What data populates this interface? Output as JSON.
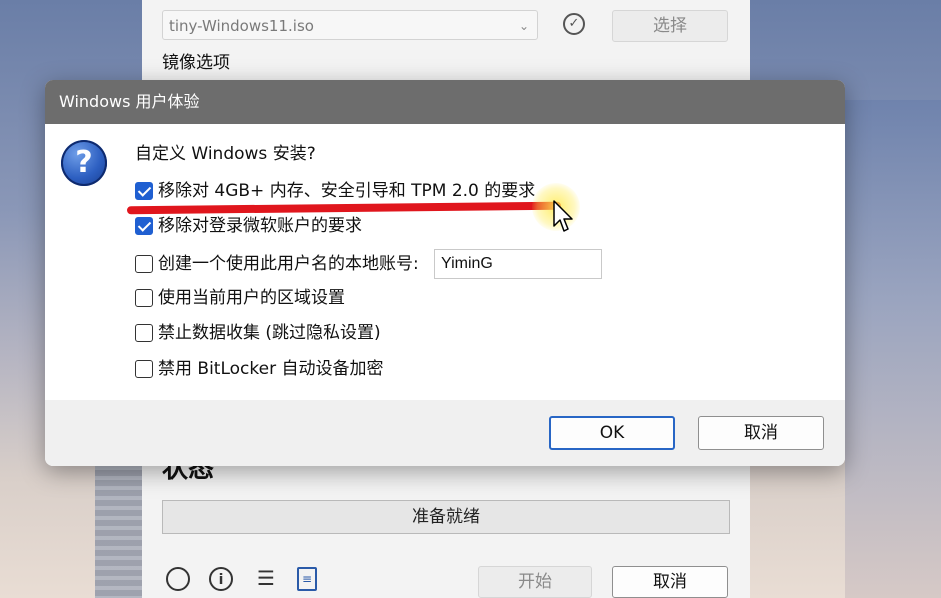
{
  "rufus": {
    "image_select_value": "tiny-Windows11.iso",
    "select_button": "选择",
    "image_option_label": "镜像选项",
    "status_title": "状态",
    "progress_text": "准备就绪",
    "start_button": "开始",
    "cancel_button": "取消"
  },
  "dialog": {
    "title": "Windows 用户体验",
    "question": "自定义 Windows 安装?",
    "options": [
      {
        "label": "移除对 4GB+ 内存、安全引导和 TPM 2.0 的要求",
        "checked": true
      },
      {
        "label": "移除对登录微软账户的要求",
        "checked": true
      },
      {
        "label": "创建一个使用此用户名的本地账号:",
        "checked": false
      },
      {
        "label": "使用当前用户的区域设置",
        "checked": false
      },
      {
        "label": "禁止数据收集 (跳过隐私设置)",
        "checked": false
      },
      {
        "label": "禁用 BitLocker 自动设备加密",
        "checked": false
      }
    ],
    "username_value": "YiminG",
    "ok_button": "OK",
    "cancel_button": "取消"
  },
  "colors": {
    "checkbox_checked": "#1f5fd1",
    "titlebar": "#6d6d6d",
    "annotation_underline": "#e0161d"
  },
  "icons": {
    "help": "question-mark-icon",
    "verify": "check-circle-icon",
    "globe": "globe-icon",
    "info": "info-icon",
    "settings": "sliders-icon",
    "log": "log-icon"
  }
}
